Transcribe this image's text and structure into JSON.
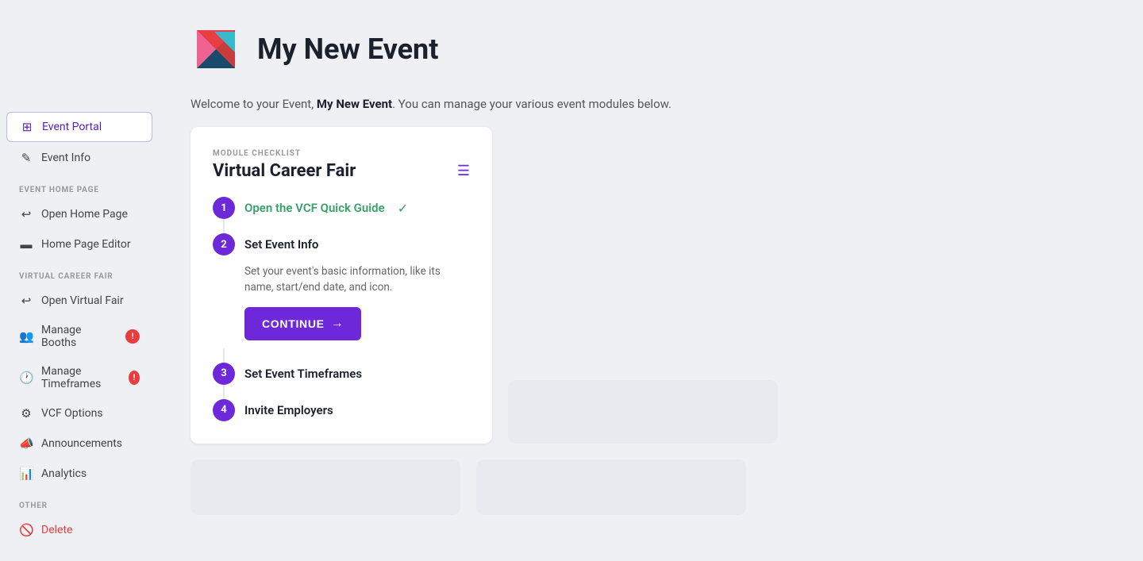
{
  "event": {
    "title": "My New Event",
    "welcome_text_prefix": "Welcome to your Event, ",
    "welcome_text_bold": "My New Event",
    "welcome_text_suffix": ". You can manage your various event modules below."
  },
  "sidebar": {
    "active_item": "Event Portal",
    "top_items": [
      {
        "id": "event-portal",
        "label": "Event Portal",
        "icon": "⊞",
        "active": true
      },
      {
        "id": "event-info",
        "label": "Event Info",
        "icon": "✎",
        "active": false
      }
    ],
    "sections": [
      {
        "label": "Event Home Page",
        "items": [
          {
            "id": "open-home-page",
            "label": "Open Home Page",
            "icon": "↩"
          },
          {
            "id": "home-page-editor",
            "label": "Home Page Editor",
            "icon": "▬"
          }
        ]
      },
      {
        "label": "Virtual Career Fair",
        "items": [
          {
            "id": "open-virtual-fair",
            "label": "Open Virtual Fair",
            "icon": "↩"
          },
          {
            "id": "manage-booths",
            "label": "Manage Booths",
            "icon": "👥",
            "badge": true
          },
          {
            "id": "manage-timeframes",
            "label": "Manage Timeframes",
            "icon": "🕐",
            "badge": true
          },
          {
            "id": "vcf-options",
            "label": "VCF Options",
            "icon": "⚙"
          },
          {
            "id": "announcements",
            "label": "Announcements",
            "icon": "📣"
          },
          {
            "id": "analytics",
            "label": "Analytics",
            "icon": "📊"
          }
        ]
      },
      {
        "label": "Other",
        "items": [
          {
            "id": "delete",
            "label": "Delete",
            "icon": "🚫",
            "danger": true
          }
        ]
      }
    ]
  },
  "checklist": {
    "module_label": "MODULE CHECKLIST",
    "title": "Virtual Career Fair",
    "steps": [
      {
        "number": "1",
        "label": "Open the VCF Quick Guide",
        "completed": true
      },
      {
        "number": "2",
        "label": "Set Event Info",
        "description": "Set your event's basic information, like its name, start/end date, and icon.",
        "has_action": true,
        "action_label": "CONTINUE"
      },
      {
        "number": "3",
        "label": "Set Event Timeframes",
        "completed": false
      },
      {
        "number": "4",
        "label": "Invite Employers",
        "completed": false
      }
    ]
  },
  "colors": {
    "primary": "#6d28d9",
    "success": "#38a169",
    "danger": "#e53e3e",
    "badge": "#e53e3e"
  }
}
